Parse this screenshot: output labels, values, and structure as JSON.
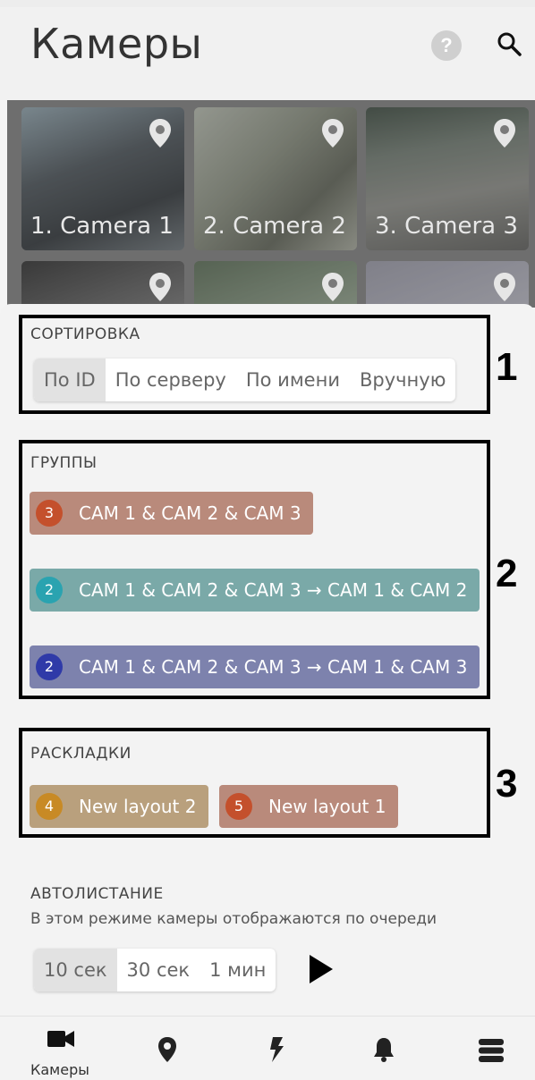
{
  "header": {
    "title": "Камеры",
    "help_icon": "question-circle-icon",
    "search_icon": "search-icon"
  },
  "cameras": [
    {
      "label": "1. Camera 1"
    },
    {
      "label": "2. Camera 2"
    },
    {
      "label": "3. Camera 3"
    },
    {
      "label": ""
    },
    {
      "label": ""
    },
    {
      "label": ""
    }
  ],
  "sorting": {
    "label": "СОРТИРОВКА",
    "options": [
      "По ID",
      "По серверу",
      "По имени",
      "Вручную"
    ],
    "selected": "По ID",
    "annotation": "1"
  },
  "groups": {
    "label": "ГРУППЫ",
    "annotation": "2",
    "items": [
      {
        "count": "3",
        "name": "CAM 1 & CAM 2 & CAM 3",
        "color": "#b98a7b",
        "badge_color": "#c4502c"
      },
      {
        "count": "2",
        "name": "CAM 1 & CAM 2 & CAM 3 → CAM 1 & CAM 2",
        "color": "#7aa9a8",
        "badge_color": "#2aa3b0"
      },
      {
        "count": "2",
        "name": "CAM 1 & CAM 2 & CAM 3 → CAM 1 & CAM 3",
        "color": "#7d82ad",
        "badge_color": "#2f3aa8"
      }
    ]
  },
  "layouts": {
    "label": "РАСКЛАДКИ",
    "annotation": "3",
    "items": [
      {
        "count": "4",
        "name": "New layout 2",
        "color": "#b9a07d",
        "badge_color": "#c88a25"
      },
      {
        "count": "5",
        "name": "New layout 1",
        "color": "#b98a7b",
        "badge_color": "#c4502c"
      }
    ]
  },
  "autoscroll": {
    "label": "АВТОЛИСТАНИЕ",
    "description": "В этом режиме камеры отображаются по очереди",
    "options": [
      "10 сек",
      "30 сек",
      "1 мин"
    ],
    "selected": "10 сек",
    "play_icon": "play-icon"
  },
  "bottom_nav": {
    "items": [
      {
        "icon": "video-camera-icon",
        "label": "Камеры"
      },
      {
        "icon": "map-pin-icon",
        "label": ""
      },
      {
        "icon": "lightning-icon",
        "label": ""
      },
      {
        "icon": "bell-icon",
        "label": ""
      },
      {
        "icon": "server-icon",
        "label": ""
      }
    ]
  }
}
